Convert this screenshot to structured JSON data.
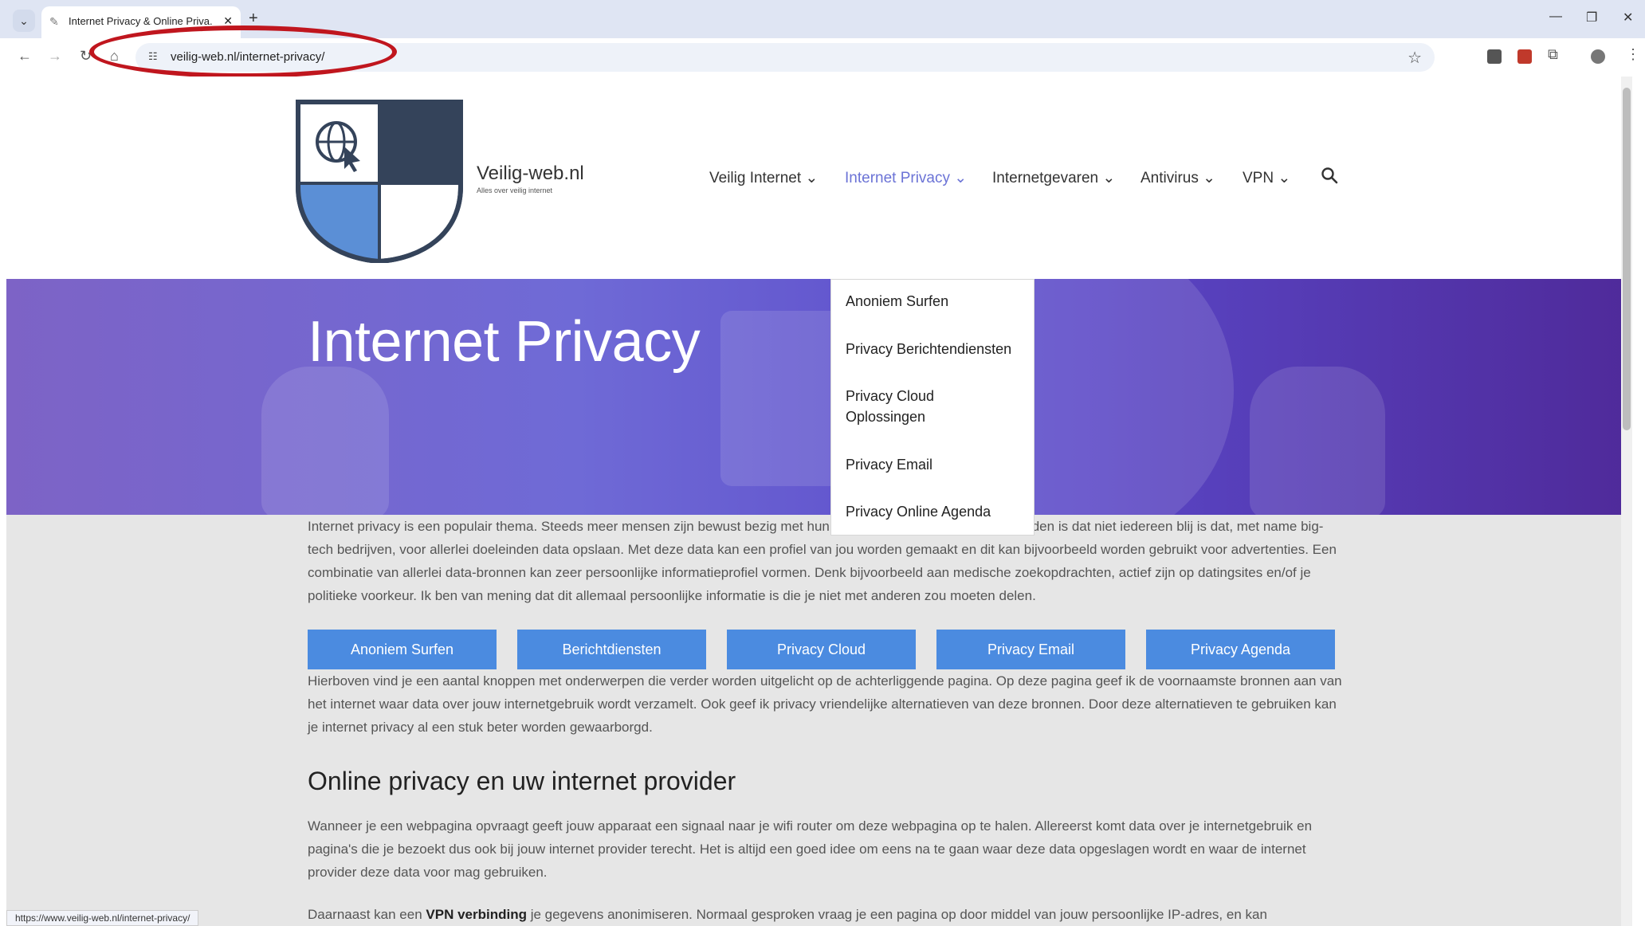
{
  "browser": {
    "tab_title": "Internet Privacy & Online Priva...",
    "tab_close": "✕",
    "new_tab": "+",
    "url": "veilig-web.nl/internet-privacy/",
    "status_url": "https://www.veilig-web.nl/internet-privacy/"
  },
  "site": {
    "brand_name": "Veilig-web.nl",
    "brand_tagline": "Alles over veilig internet",
    "nav": [
      {
        "label": "Veilig Internet ⌄"
      },
      {
        "label": "Internet Privacy ⌄"
      },
      {
        "label": "Internetgevaren ⌄"
      },
      {
        "label": "Antivirus ⌄"
      },
      {
        "label": "VPN ⌄"
      }
    ],
    "dropdown": [
      {
        "label": "Anoniem Surfen"
      },
      {
        "label": "Privacy Berichtendiensten"
      },
      {
        "label": "Privacy Cloud Oplossingen"
      },
      {
        "label": "Privacy Email"
      },
      {
        "label": "Privacy Online Agenda"
      }
    ],
    "hero_title": "Internet Privacy"
  },
  "content": {
    "intro": "Internet privacy is een populair thema. Steeds meer mensen zijn bewust bezig met hun online privacy. Een belangrijke reden is dat niet iedereen blij is dat, met name big-tech bedrijven, voor allerlei doeleinden data opslaan. Met deze data kan een profiel van jou worden gemaakt en dit kan bijvoorbeeld worden gebruikt voor advertenties. Een combinatie van allerlei data-bronnen kan zeer persoonlijke informatieprofiel vormen. Denk bijvoorbeeld aan medische zoekopdrachten, actief zijn op datingsites en/of je politieke voorkeur. Ik ben van mening dat dit allemaal persoonlijke informatie is die je niet met anderen zou moeten delen.",
    "buttons": [
      {
        "label": "Anoniem Surfen"
      },
      {
        "label": "Berichtdiensten"
      },
      {
        "label": "Privacy Cloud"
      },
      {
        "label": "Privacy Email"
      },
      {
        "label": "Privacy Agenda"
      }
    ],
    "para2": "Hierboven vind je een aantal knoppen met onderwerpen die verder worden uitgelicht op de achterliggende pagina. Op deze pagina geef ik de voornaamste bronnen aan van het internet waar data over jouw internetgebruik wordt verzamelt. Ook geef ik privacy vriendelijke alternatieven van deze bronnen. Door deze alternatieven te gebruiken kan je internet privacy al een stuk beter worden gewaarborgd.",
    "heading": "Online privacy en uw internet provider",
    "para3": "Wanneer je een webpagina opvraagt geeft jouw apparaat een signaal naar je wifi router om deze webpagina op te halen. Allereerst komt data over je internetgebruik en pagina's die je bezoekt dus ook bij jouw internet provider terecht. Het is altijd een goed idee om eens na te gaan waar deze data opgeslagen wordt en waar de internet provider deze data voor mag gebruiken.",
    "para4_pre": "Daarnaast kan een ",
    "para4_bold": "VPN verbinding",
    "para4_post": " je gegevens anonimiseren. Normaal gesproken vraag je een pagina op door middel van jouw persoonlijke IP-adres, en kan"
  },
  "colors": {
    "accent": "#4b8be0",
    "nav_active": "#6b73d6",
    "annotation": "#c0161e"
  }
}
